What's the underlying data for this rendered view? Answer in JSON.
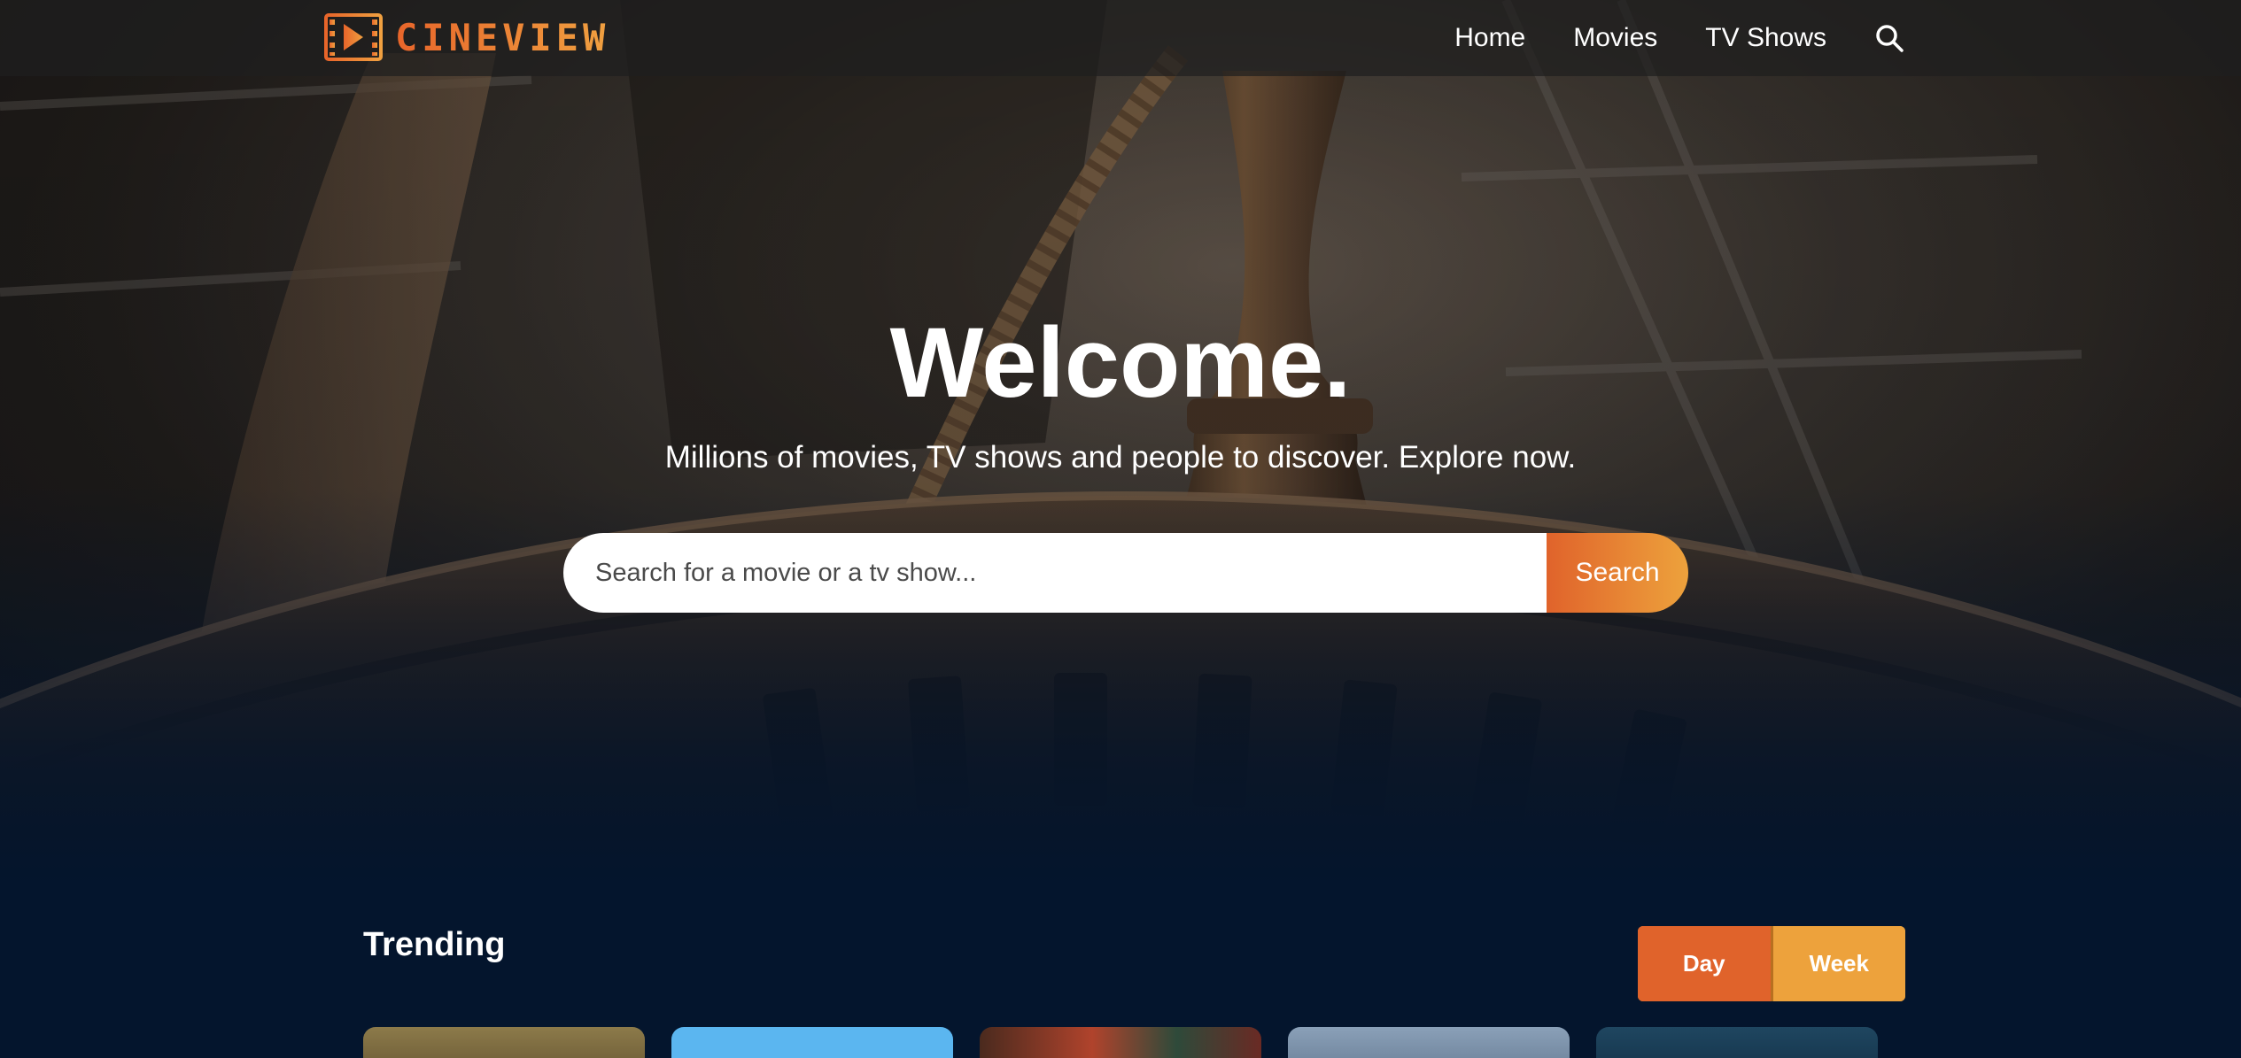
{
  "header": {
    "logo_text": "CINEVIEW",
    "nav": [
      {
        "label": "Home"
      },
      {
        "label": "Movies"
      },
      {
        "label": "TV Shows"
      }
    ],
    "search_icon": "search-icon"
  },
  "hero": {
    "title": "Welcome.",
    "subtitle": "Millions of movies, TV shows and people to discover. Explore now.",
    "search": {
      "placeholder": "Search for a movie or a tv show...",
      "button_label": "Search"
    }
  },
  "trending": {
    "title": "Trending",
    "tabs": [
      {
        "label": "Day",
        "active": true
      },
      {
        "label": "Week",
        "active": false
      }
    ],
    "cards_visible": 5
  },
  "colors": {
    "background": "#04152d",
    "accent_orange": "#e0632b",
    "accent_gold": "#eda23c",
    "header_bg": "#1e1e1e"
  }
}
